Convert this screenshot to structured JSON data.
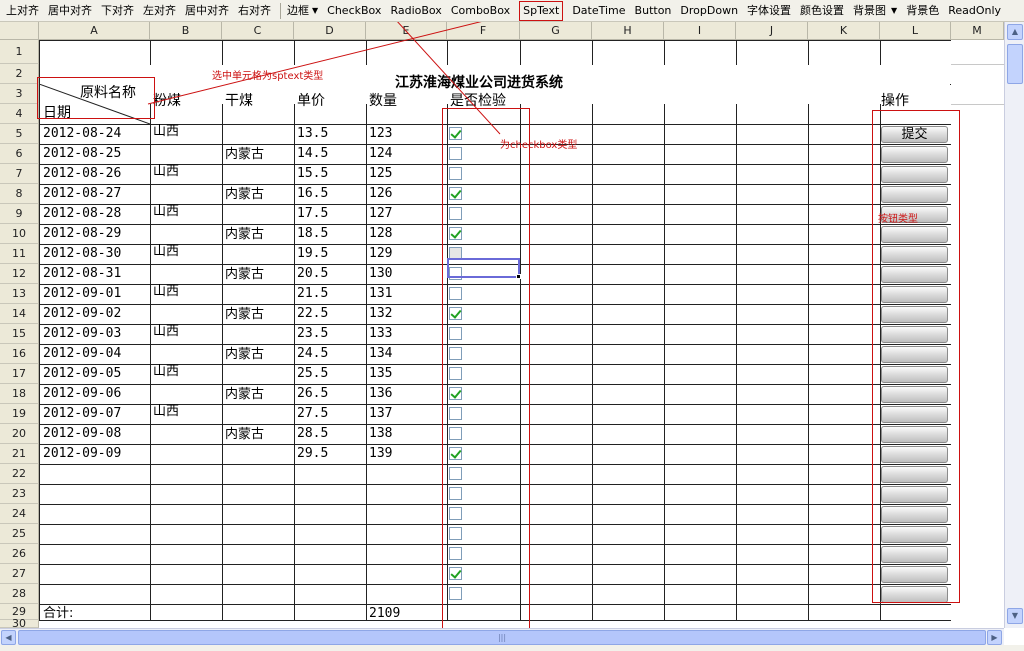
{
  "toolbar": {
    "items": [
      "上对齐",
      "居中对齐",
      "下对齐",
      "左对齐",
      "居中对齐",
      "右对齐"
    ],
    "border_label": "边框",
    "types": [
      "CheckBox",
      "RadioBox",
      "ComboBox",
      "SpText",
      "DateTime",
      "Button",
      "DropDown",
      "字体设置",
      "颜色设置",
      "背景图"
    ],
    "tail": [
      "背景色",
      "ReadOnly"
    ]
  },
  "columns": [
    "A",
    "B",
    "C",
    "D",
    "E",
    "F",
    "G",
    "H",
    "I",
    "J",
    "K",
    "L",
    "M"
  ],
  "rows": [
    "1",
    "2",
    "3",
    "4",
    "5",
    "6",
    "7",
    "8",
    "9",
    "10",
    "11",
    "12",
    "13",
    "14",
    "15",
    "16",
    "17",
    "18",
    "19",
    "20",
    "21",
    "22",
    "23",
    "24",
    "25",
    "26",
    "27",
    "28",
    "29",
    "30"
  ],
  "sheet": {
    "title": "江苏淮海煤业公司进货系统",
    "diag_top": "原料名称",
    "diag_bottom": "日期",
    "headers": {
      "b": "粉煤",
      "c": "干煤",
      "d": "单价",
      "e": "数量",
      "f": "是否检验",
      "l": "操作"
    },
    "records": [
      {
        "date": "2012-08-24",
        "b": "山西",
        "c": "",
        "price": "13.5",
        "qty": "123",
        "checked": true
      },
      {
        "date": "2012-08-25",
        "b": "",
        "c": "内蒙古",
        "price": "14.5",
        "qty": "124",
        "checked": false
      },
      {
        "date": "2012-08-26",
        "b": "山西",
        "c": "",
        "price": "15.5",
        "qty": "125",
        "checked": false
      },
      {
        "date": "2012-08-27",
        "b": "",
        "c": "内蒙古",
        "price": "16.5",
        "qty": "126",
        "checked": true
      },
      {
        "date": "2012-08-28",
        "b": "山西",
        "c": "",
        "price": "17.5",
        "qty": "127",
        "checked": false
      },
      {
        "date": "2012-08-29",
        "b": "",
        "c": "内蒙古",
        "price": "18.5",
        "qty": "128",
        "checked": true
      },
      {
        "date": "2012-08-30",
        "b": "山西",
        "c": "",
        "price": "19.5",
        "qty": "129",
        "checked": false
      },
      {
        "date": "2012-08-31",
        "b": "",
        "c": "内蒙古",
        "price": "20.5",
        "qty": "130",
        "checked": false
      },
      {
        "date": "2012-09-01",
        "b": "山西",
        "c": "",
        "price": "21.5",
        "qty": "131",
        "checked": false
      },
      {
        "date": "2012-09-02",
        "b": "",
        "c": "内蒙古",
        "price": "22.5",
        "qty": "132",
        "checked": true
      },
      {
        "date": "2012-09-03",
        "b": "山西",
        "c": "",
        "price": "23.5",
        "qty": "133",
        "checked": false
      },
      {
        "date": "2012-09-04",
        "b": "",
        "c": "内蒙古",
        "price": "24.5",
        "qty": "134",
        "checked": false
      },
      {
        "date": "2012-09-05",
        "b": "山西",
        "c": "",
        "price": "25.5",
        "qty": "135",
        "checked": false
      },
      {
        "date": "2012-09-06",
        "b": "",
        "c": "内蒙古",
        "price": "26.5",
        "qty": "136",
        "checked": true
      },
      {
        "date": "2012-09-07",
        "b": "山西",
        "c": "",
        "price": "27.5",
        "qty": "137",
        "checked": false
      },
      {
        "date": "2012-09-08",
        "b": "",
        "c": "内蒙古",
        "price": "28.5",
        "qty": "138",
        "checked": false
      },
      {
        "date": "2012-09-09",
        "b": "",
        "c": "",
        "price": "29.5",
        "qty": "139",
        "checked": true
      }
    ],
    "empty_checks": [
      false,
      false,
      false,
      false,
      false,
      true,
      false
    ],
    "total_label": "合计:",
    "total_value": "2109",
    "submit_label": "提交"
  },
  "annotations": {
    "sptext_note": "选中单元格为sptext类型",
    "checkbox_note": "为checkbox类型",
    "button_note": "按钮类型"
  },
  "colors": {
    "accent_red": "#cc1111",
    "check_green": "#21a121",
    "selection": "#6a6ad8"
  }
}
